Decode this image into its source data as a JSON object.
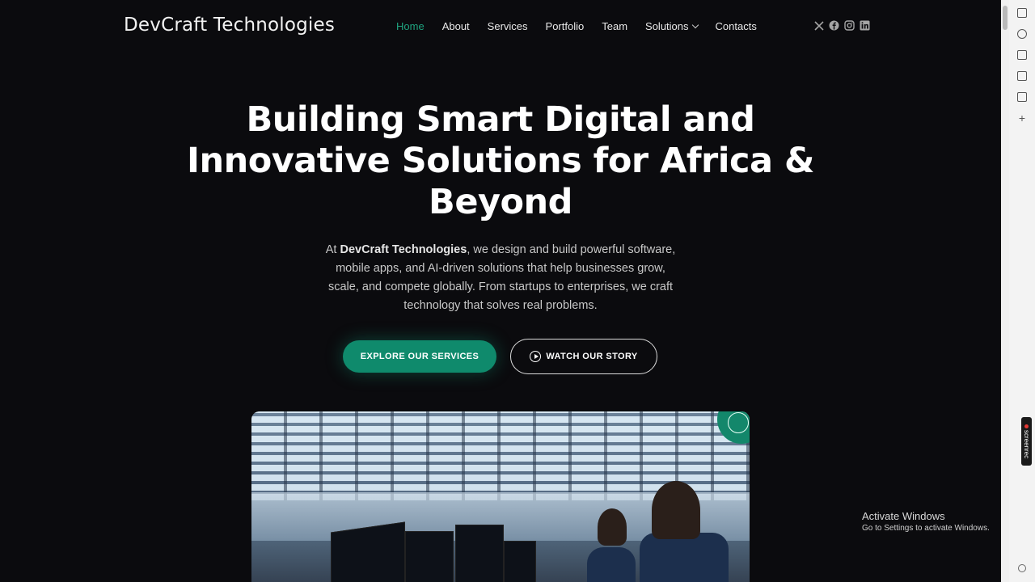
{
  "header": {
    "logo": "DevCraft Technologies",
    "nav": [
      {
        "label": "Home",
        "active": true
      },
      {
        "label": "About"
      },
      {
        "label": "Services"
      },
      {
        "label": "Portfolio"
      },
      {
        "label": "Team"
      },
      {
        "label": "Solutions",
        "dropdown": true
      },
      {
        "label": "Contacts"
      }
    ],
    "socials": [
      "x-icon",
      "facebook-icon",
      "instagram-icon",
      "linkedin-icon"
    ]
  },
  "hero": {
    "title": "Building Smart Digital and Innovative Solutions for Africa & Beyond",
    "desc_prefix": "At ",
    "desc_brand": "DevCraft Technologies",
    "desc_rest": ", we design and build powerful software, mobile apps, and AI-driven solutions that help businesses grow, scale, and compete globally. From startups to enterprises, we craft technology that solves real problems.",
    "cta_primary": "EXPLORE OUR SERVICES",
    "cta_secondary": "WATCH OUR STORY"
  },
  "overlay": {
    "activate_title": "Activate Windows",
    "activate_sub": "Go to Settings to activate Windows.",
    "screenrec": "screenrec"
  },
  "colors": {
    "accent": "#0f8a6c",
    "active_nav": "#1fa37f",
    "background": "#0b0b0e"
  }
}
